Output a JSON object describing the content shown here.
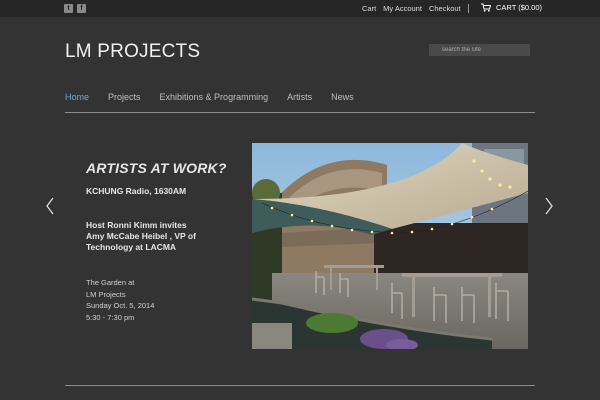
{
  "topbar": {
    "social": [
      {
        "icon": "twitter-icon",
        "glyph": "t"
      },
      {
        "icon": "facebook-icon",
        "glyph": "f"
      }
    ],
    "links": [
      "Cart",
      "My Account",
      "Checkout"
    ],
    "cart_label": "CART ($0.00)"
  },
  "header": {
    "logo": "LM PROJECTS",
    "search_placeholder": "search the site"
  },
  "nav": {
    "items": [
      "Home",
      "Projects",
      "Exhibitions & Programming",
      "Artists",
      "News"
    ],
    "active": "Home",
    "active_color": "#6fa8d6"
  },
  "slide": {
    "headline": "ARTISTS AT WORK?",
    "subhead": "KCHUNG Radio, 1630AM",
    "desc_line1": "Host Ronni Kimm invites",
    "desc_line2": "Amy McCabe Heibel , VP of",
    "desc_line3": "Technology at LACMA",
    "venue1": "The Garden at",
    "venue2": "LM Projects",
    "date": "Sunday Oct. 5, 2014",
    "time": "5:30 - 7:30 pm"
  }
}
